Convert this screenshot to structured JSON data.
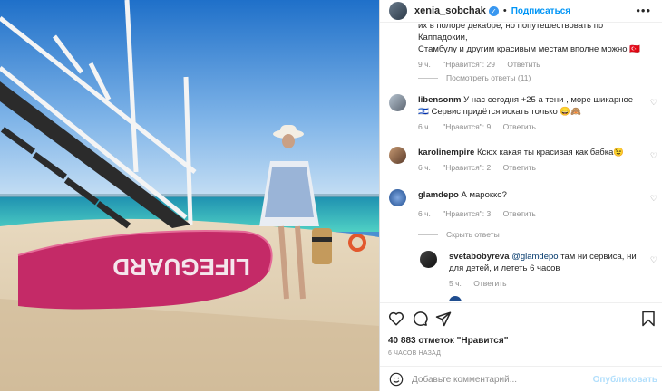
{
  "photo": {
    "board_text": "LIFEGUARD"
  },
  "header": {
    "username": "xenia_sobchak",
    "verified": "✓",
    "separator": "•",
    "follow": "Подписаться",
    "more": "•••"
  },
  "comments": {
    "top_partial": {
      "line1": "их в полоре декабре, но попутешествовать по Каппадокии,",
      "line2": "Стамбулу и другим красивым местам вполне можно 🇹🇷",
      "time": "9 ч.",
      "likes": "\"Нравится\": 29",
      "reply": "Ответить"
    },
    "view_replies": "Посмотреть ответы (11)",
    "items": [
      {
        "user": "libensonm",
        "text": "У нас сегодня +25 а тени , море шикарное 🇮🇱 Сервис придётся искать только 😄🙈",
        "time": "6 ч.",
        "likes": "\"Нравится\": 9",
        "reply": "Ответить"
      },
      {
        "user": "karolinempire",
        "text": "Ксюх какая ты красивая как бабка😉",
        "time": "6 ч.",
        "likes": "\"Нравится\": 2",
        "reply": "Ответить"
      },
      {
        "user": "glamdepo",
        "text": "А марокко?",
        "time": "6 ч.",
        "likes": "\"Нравится\": 3",
        "reply": "Ответить"
      }
    ],
    "hide_replies": "Скрыть ответы",
    "reply_item": {
      "user": "svetabobyreva",
      "mention": "@glamdepo",
      "text": "там ни сервиса, ни для детей, и лететь 6 часов",
      "time": "5 ч.",
      "reply": "Ответить"
    }
  },
  "actions": {
    "likes": "40 883 отметок \"Нравится\"",
    "time": "6 ЧАСОВ НАЗАД"
  },
  "add_comment": {
    "placeholder": "Добавьте комментарий...",
    "publish": "Опубликовать"
  },
  "colors": {
    "accent": "#0095f6",
    "board": "#c42a67"
  }
}
